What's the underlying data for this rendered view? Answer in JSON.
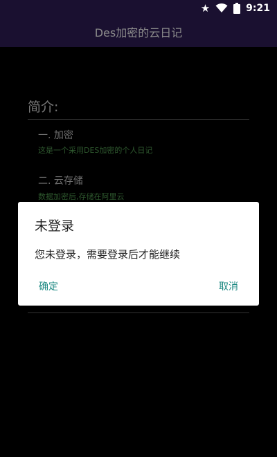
{
  "status_bar": {
    "time": "9:21",
    "icons": [
      "star-icon",
      "wifi-icon",
      "battery-icon"
    ]
  },
  "app_bar": {
    "title": "Des加密的云日记"
  },
  "content": {
    "section_title": "简介:",
    "features": [
      {
        "title": "一. 加密",
        "description": "这是一个采用DES加密的个人日记"
      },
      {
        "title": "二. 云存储",
        "description": "数据加密后,存储在阿里云"
      }
    ]
  },
  "dialog": {
    "title": "未登录",
    "message": "您未登录，需要登录后才能继续",
    "confirm_label": "确定",
    "cancel_label": "取消"
  },
  "colors": {
    "app_bar_bg": "#1a1030",
    "accent": "#1f8a83",
    "description_green": "#2f5a2f"
  }
}
